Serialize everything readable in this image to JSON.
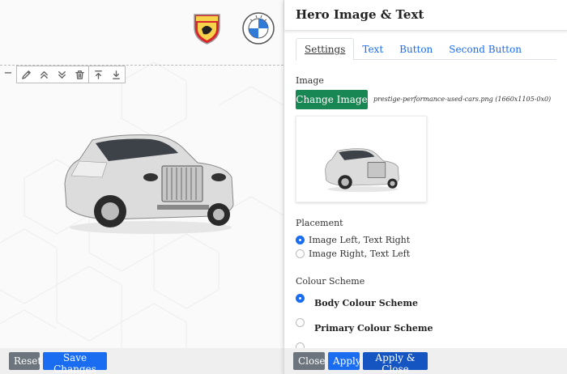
{
  "canvas": {
    "reset_label": "Reset",
    "save_label": "Save Changes",
    "collapse_symbol": "−",
    "toolbar_icons": [
      "pencil-icon",
      "chevron-double-up-icon",
      "chevron-double-down-icon",
      "trash-icon",
      "arrow-up-to-line-icon",
      "arrow-down-to-line-icon"
    ],
    "logos": [
      "abarth-logo",
      "bmw-logo"
    ]
  },
  "panel": {
    "title": "Hero Image & Text",
    "tabs": [
      {
        "label": "Settings",
        "active": true
      },
      {
        "label": "Text",
        "active": false
      },
      {
        "label": "Button",
        "active": false
      },
      {
        "label": "Second Button",
        "active": false
      }
    ],
    "image": {
      "label": "Image",
      "change_button": "Change Image",
      "filename": "prestige-performance-used-cars.png (1660x1105-0x0)"
    },
    "placement": {
      "label": "Placement",
      "options": [
        {
          "label": "Image Left, Text Right",
          "checked": true
        },
        {
          "label": "Image Right, Text Left",
          "checked": false
        }
      ]
    },
    "colour_scheme": {
      "label": "Colour Scheme",
      "options": [
        {
          "label": "Body Colour Scheme",
          "checked": true
        },
        {
          "label": "Primary Colour Scheme",
          "checked": false
        }
      ]
    },
    "footer": {
      "close_label": "Close",
      "apply_label": "Apply",
      "apply_close_label": "Apply & Close"
    }
  },
  "colors": {
    "primary_blue": "#1a6cf0",
    "success_green": "#198754",
    "secondary_gray": "#6c757d"
  }
}
